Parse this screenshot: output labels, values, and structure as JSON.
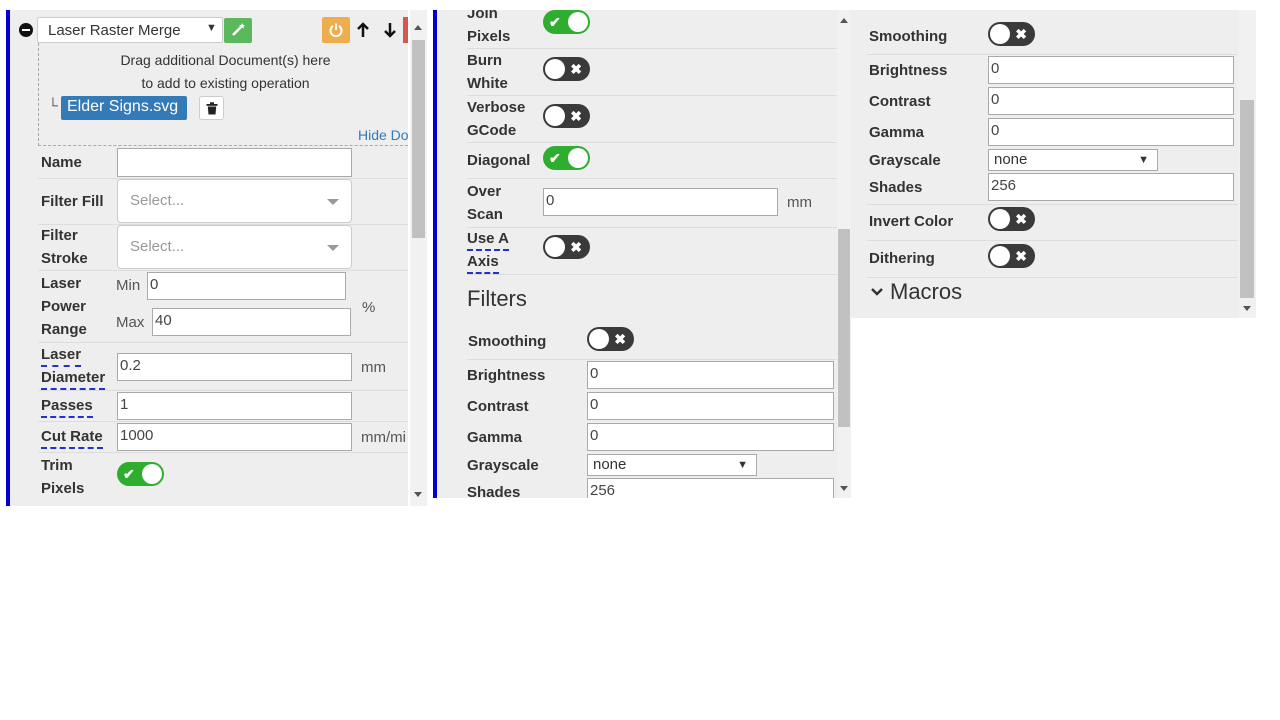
{
  "left": {
    "operation_select": "Laser Raster Merge",
    "drop_hint_1": "Drag additional Document(s) here",
    "drop_hint_2": "to add to existing operation",
    "tree_mark": "└",
    "doc_name": "Elder Signs.svg",
    "hide_docs": "Hide Do",
    "name_label": "Name",
    "name_value": "",
    "filter_fill_label": "Filter Fill",
    "filter_fill_placeholder": "Select...",
    "filter_stroke_label_1": "Filter",
    "filter_stroke_label_2": "Stroke",
    "filter_stroke_placeholder": "Select...",
    "power_label_1": "Laser",
    "power_label_2": "Power",
    "power_label_3": "Range",
    "min_label": "Min",
    "min_value": "0",
    "max_label": "Max",
    "max_value": "40",
    "power_unit": "%",
    "diameter_label_1": "Laser",
    "diameter_label_2": "Diameter",
    "diameter_value": "0.2",
    "diameter_unit": "mm",
    "passes_label": "Passes",
    "passes_value": "1",
    "cut_rate_label": "Cut Rate",
    "cut_rate_value": "1000",
    "cut_rate_unit": "mm/mi",
    "trim_label_1": "Trim",
    "trim_label_2": "Pixels",
    "trim_on": true
  },
  "middle": {
    "join_label_1": "Join",
    "join_label_2": "Pixels",
    "join_on": true,
    "burn_label_1": "Burn",
    "burn_label_2": "White",
    "burn_on": false,
    "verbose_label_1": "Verbose",
    "verbose_label_2": "GCode",
    "verbose_on": false,
    "diagonal_label": "Diagonal",
    "diagonal_on": true,
    "overscan_label_1": "Over",
    "overscan_label_2": "Scan",
    "overscan_value": "0",
    "overscan_unit": "mm",
    "aaxis_label_1": "Use A",
    "aaxis_label_2": "Axis",
    "aaxis_on": false,
    "filters_heading": "Filters",
    "smoothing_label": "Smoothing",
    "smoothing_on": false,
    "brightness_label": "Brightness",
    "brightness_value": "0",
    "contrast_label": "Contrast",
    "contrast_value": "0",
    "gamma_label": "Gamma",
    "gamma_value": "0",
    "grayscale_label": "Grayscale",
    "grayscale_value": "none",
    "shades_label": "Shades",
    "shades_value": "256"
  },
  "right": {
    "smoothing_label": "Smoothing",
    "smoothing_on": false,
    "brightness_label": "Brightness",
    "brightness_value": "0",
    "contrast_label": "Contrast",
    "contrast_value": "0",
    "gamma_label": "Gamma",
    "gamma_value": "0",
    "grayscale_label": "Grayscale",
    "grayscale_value": "none",
    "shades_label": "Shades",
    "shades_value": "256",
    "invert_label": "Invert Color",
    "invert_on": false,
    "dithering_label": "Dithering",
    "dithering_on": false,
    "macros_label": "Macros"
  },
  "icons": {
    "toggle_on": "check-icon",
    "toggle_off": "x-icon",
    "remove": "minus-circle-icon",
    "wand": "magic-wand-icon",
    "power": "power-icon",
    "up": "arrow-up-icon",
    "down": "arrow-down-icon",
    "trash": "trash-icon",
    "chevron": "chevron-down-icon"
  },
  "colors": {
    "accent_blue": "#0000cc",
    "toggle_on": "#2fad2f",
    "toggle_off": "#3a3a3a",
    "doc_chip": "#337ab7",
    "wand_button": "#5cb85c",
    "power_button": "#f0ad4e"
  }
}
